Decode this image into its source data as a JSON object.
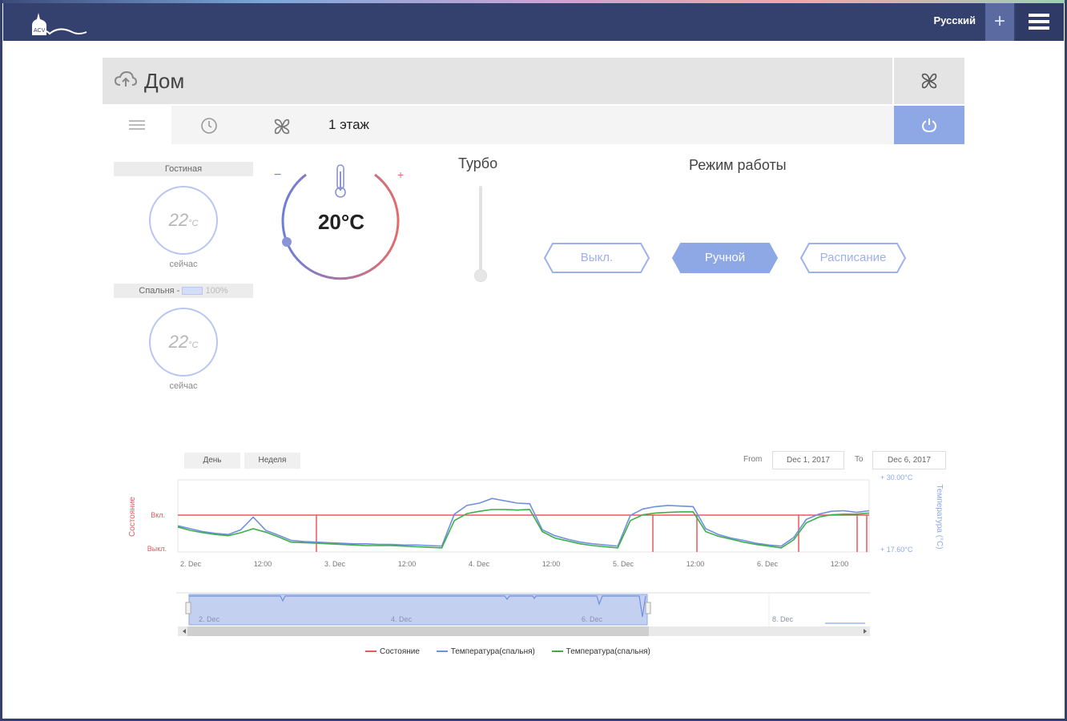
{
  "header": {
    "logo_text": "ACV",
    "language": "Русский",
    "add_label": "+",
    "colors": {
      "bar": "#34406e",
      "accent": "#8ea8e6"
    }
  },
  "card": {
    "title": "Дом",
    "floor_label": "1 этаж",
    "tabs": [
      "list-icon",
      "clock-icon",
      "fan-icon"
    ]
  },
  "rooms": [
    {
      "name": "Гостиная",
      "temp": "22",
      "unit": "°C",
      "sub": "сейчас"
    },
    {
      "name": "Спальня -",
      "battery": "100%",
      "temp": "22",
      "unit": "°C",
      "sub": "сейчас"
    }
  ],
  "thermostat": {
    "setpoint": "20°C",
    "minus": "−",
    "plus": "+"
  },
  "turbo": {
    "label": "Турбо",
    "level": 0
  },
  "mode": {
    "label": "Режим работы",
    "options": [
      "Выкл.",
      "Ручной",
      "Расписание"
    ],
    "selected": "Ручной"
  },
  "chart_controls": {
    "day_label": "День",
    "week_label": "Неделя",
    "from_label": "From",
    "from_value": "Dec 1, 2017",
    "to_label": "To",
    "to_value": "Dec 6, 2017"
  },
  "chart_data": {
    "type": "line",
    "x_ticks": [
      "2. Dec",
      "12:00",
      "3. Dec",
      "12:00",
      "4. Dec",
      "12:00",
      "5. Dec",
      "12:00",
      "6. Dec",
      "12:00"
    ],
    "left_axis": {
      "label": "Состояние",
      "ticks": [
        "Вкл.",
        "Выкл."
      ]
    },
    "right_axis": {
      "label": "Температура (°C)",
      "max_label": "+ 30.00°C",
      "min_label": "+ 17.60°C",
      "range": [
        17.6,
        30.0
      ]
    },
    "navigator_ticks": [
      "2. Dec",
      "4. Dec",
      "6. Dec",
      "8. Dec"
    ],
    "series": [
      {
        "name": "Состояние",
        "color": "#e8595f",
        "values": [
          1,
          1,
          1,
          1,
          1,
          1,
          1,
          1,
          1,
          1,
          1,
          1,
          1,
          1,
          1,
          1,
          1,
          1,
          1,
          1,
          1,
          1,
          1,
          1,
          1,
          1,
          1,
          1,
          1,
          1,
          1,
          1,
          1,
          1,
          1,
          1,
          1,
          1,
          1,
          1,
          1,
          1,
          1,
          1,
          1,
          1,
          1,
          1,
          1,
          1,
          1,
          1,
          1,
          1,
          1,
          1,
          1,
          1,
          1,
          1
        ]
      },
      {
        "name": "Температура(спальня)",
        "color": "#6f8fe0",
        "values": [
          22.1,
          21.6,
          21.1,
          20.8,
          20.6,
          21.4,
          23.6,
          21.3,
          20.5,
          19.6,
          19.4,
          19.3,
          19.2,
          19.1,
          19.0,
          19.0,
          18.9,
          18.9,
          18.8,
          18.8,
          18.7,
          18.6,
          24.1,
          25.6,
          26.0,
          26.8,
          26.4,
          26.0,
          25.9,
          21.4,
          20.4,
          19.8,
          19.3,
          19.0,
          18.8,
          18.6,
          23.9,
          25.0,
          25.4,
          25.6,
          25.5,
          25.4,
          21.6,
          20.6,
          20.0,
          19.6,
          19.1,
          18.8,
          18.6,
          20.1,
          23.2,
          24.1,
          24.6,
          24.7,
          24.4,
          24.7
        ]
      },
      {
        "name": "Температура(спальня)",
        "color": "#3fae4a",
        "values": [
          21.9,
          21.3,
          20.9,
          20.6,
          20.4,
          20.9,
          21.6,
          21.0,
          20.2,
          19.3,
          19.2,
          19.1,
          19.0,
          18.9,
          18.8,
          18.7,
          18.7,
          18.7,
          18.6,
          18.5,
          18.4,
          18.3,
          23.0,
          24.2,
          24.6,
          24.9,
          24.9,
          24.8,
          24.9,
          21.1,
          20.0,
          19.5,
          19.0,
          18.7,
          18.5,
          18.3,
          23.0,
          24.0,
          24.3,
          24.4,
          24.5,
          24.5,
          21.1,
          20.3,
          19.8,
          19.3,
          18.9,
          18.6,
          18.3,
          19.7,
          22.6,
          23.6,
          24.0,
          24.1,
          24.1,
          24.3
        ]
      }
    ]
  }
}
